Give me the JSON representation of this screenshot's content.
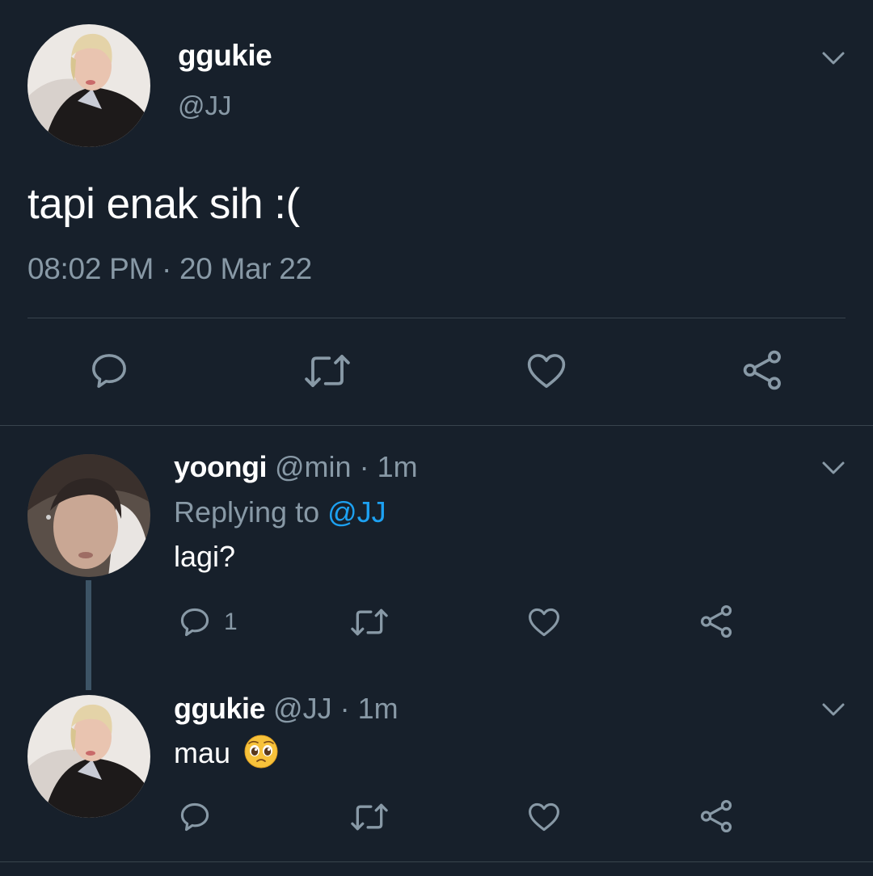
{
  "main_tweet": {
    "display_name": "ggukie",
    "handle": "@JJ",
    "text": "tapi enak sih :(",
    "timestamp": "08:02 PM · 20 Mar 22",
    "actions": [
      "reply-icon",
      "retweet-icon",
      "like-icon",
      "share-icon"
    ]
  },
  "replies": [
    {
      "display_name": "yoongi",
      "handle": "@min",
      "separator": "·",
      "time": "1m",
      "replying_label": "Replying to",
      "replying_to": "@JJ",
      "text": "lagi?",
      "reply_count": "1"
    },
    {
      "display_name": "ggukie",
      "handle": "@JJ",
      "separator": "·",
      "time": "1m",
      "text": "mau",
      "emoji": "pleading-face-emoji"
    }
  ],
  "colors": {
    "background": "#17202b",
    "primary_text": "#ffffff",
    "secondary_text": "#8899a6",
    "accent": "#1da1f2",
    "divider": "#38444d",
    "thread_line": "#3d5466"
  }
}
